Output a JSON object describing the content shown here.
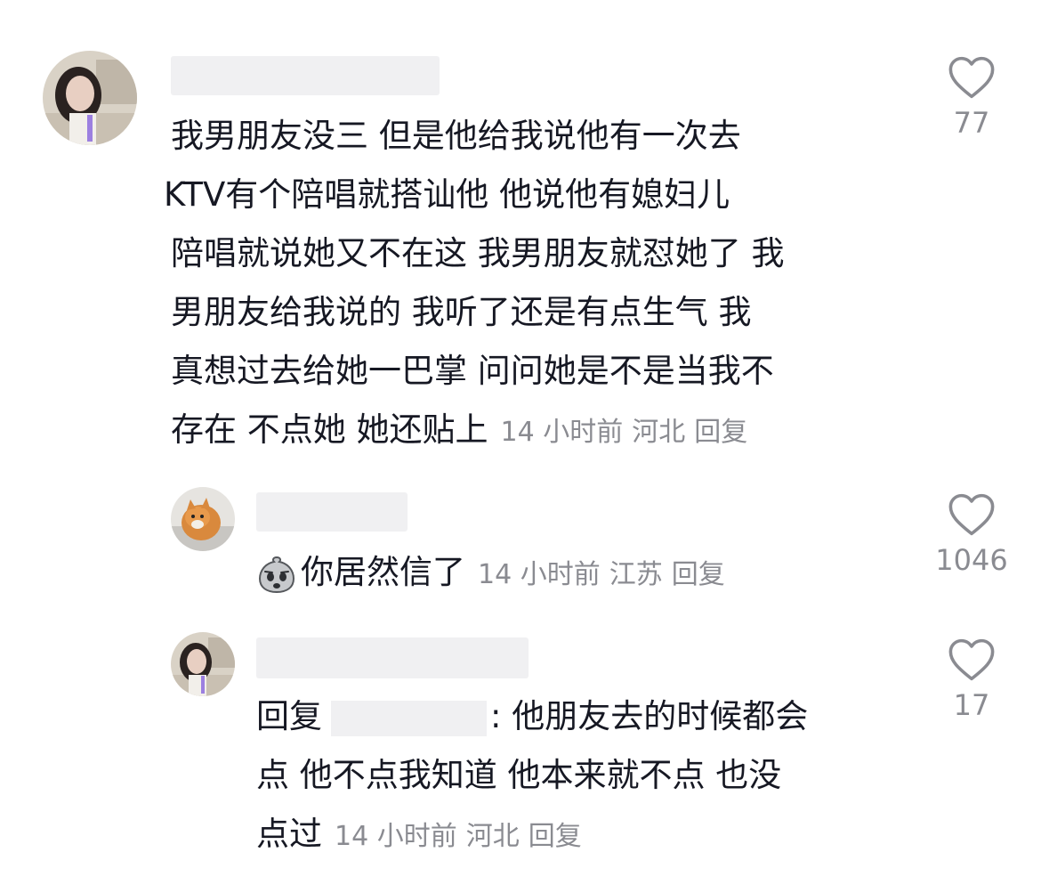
{
  "comments": [
    {
      "lines": [
        "我男朋友没三  但是他给我说他有一次去",
        " KTV有个陪唱就搭讪他  他说他有媳妇儿",
        "陪唱就说她又不在这  我男朋友就怼她了 我",
        "男朋友给我说的  我听了还是有点生气  我",
        "真想过去给她一巴掌  问问她是不是当我不",
        "存在  不点她 她还贴上"
      ],
      "time": "14 小时前",
      "location": "河北",
      "reply_label": "回复",
      "likes": "77",
      "like_icon": "heart-outline-icon"
    },
    {
      "emoji": "worried-face-emoji",
      "text": "你居然信了",
      "time": "14 小时前",
      "location": "江苏",
      "reply_label": "回复",
      "likes": "1046",
      "like_icon": "heart-outline-icon"
    },
    {
      "reply_prefix": "回复",
      "lines": [
        ": 他朋友去的时候都会",
        "点  他不点我知道  他本来就不点 也没",
        "点过"
      ],
      "time": "14 小时前",
      "location": "河北",
      "reply_label": "回复",
      "likes": "17",
      "like_icon": "heart-outline-icon"
    }
  ],
  "colors": {
    "text": "#161823",
    "meta": "#8a8b91",
    "blur": "#f0f0f2",
    "icon": "#8a8b91"
  }
}
